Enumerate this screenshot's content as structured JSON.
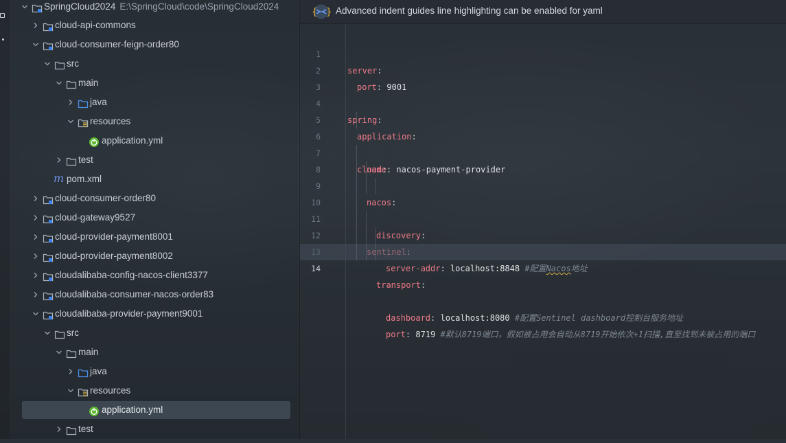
{
  "project": {
    "root": {
      "name": "SpringCloud2024",
      "path": "E:\\SpringCloud\\code\\SpringCloud2024"
    },
    "items": [
      {
        "label": "cloud-api-commons"
      },
      {
        "label": "cloud-consumer-feign-order80"
      },
      {
        "label": "src"
      },
      {
        "label": "main"
      },
      {
        "label": "java"
      },
      {
        "label": "resources"
      },
      {
        "label": "application.yml"
      },
      {
        "label": "test"
      },
      {
        "label": "pom.xml"
      },
      {
        "label": "cloud-consumer-order80"
      },
      {
        "label": "cloud-gateway9527"
      },
      {
        "label": "cloud-provider-payment8001"
      },
      {
        "label": "cloud-provider-payment8002"
      },
      {
        "label": "cloudalibaba-config-nacos-client3377"
      },
      {
        "label": "cloudalibaba-consumer-nacos-order83"
      },
      {
        "label": "cloudalibaba-provider-payment9001"
      },
      {
        "label": "src"
      },
      {
        "label": "main"
      },
      {
        "label": "java"
      },
      {
        "label": "resources"
      },
      {
        "label": "application.yml"
      },
      {
        "label": "test"
      }
    ]
  },
  "editor": {
    "banner": "Advanced indent guides line highlighting can be enabled for yaml",
    "current_line": 14,
    "lines": [
      {
        "n": "1",
        "key": "server",
        "colon": ":",
        "value": "",
        "comment": ""
      },
      {
        "n": "2",
        "key": "port",
        "colon": ":",
        "value": " 9001",
        "comment": ""
      },
      {
        "n": "3",
        "key": "",
        "colon": "",
        "value": "",
        "comment": ""
      },
      {
        "n": "4",
        "key": "spring",
        "colon": ":",
        "value": "",
        "comment": ""
      },
      {
        "n": "5",
        "key": "application",
        "colon": ":",
        "value": "",
        "comment": ""
      },
      {
        "n": "6",
        "key": "name",
        "colon": ":",
        "value": " nacos-payment-provider",
        "comment": ""
      },
      {
        "n": "7",
        "key": "cloud",
        "colon": ":",
        "value": "",
        "comment": ""
      },
      {
        "n": "8",
        "key": "nacos",
        "colon": ":",
        "value": "",
        "comment": ""
      },
      {
        "n": "9",
        "key": "discovery",
        "colon": ":",
        "value": "",
        "comment": ""
      },
      {
        "n": "10",
        "key": "server-addr",
        "colon": ":",
        "value": " localhost:8848 ",
        "comment_a": "#配置",
        "comment_b": "Nacos",
        "comment_c": "地址"
      },
      {
        "n": "11",
        "key": "sentinel",
        "colon": ":",
        "value": "",
        "comment": ""
      },
      {
        "n": "12",
        "key": "transport",
        "colon": ":",
        "value": "",
        "comment": ""
      },
      {
        "n": "13",
        "key": "dashboard",
        "colon": ":",
        "value": " localhost:8080 ",
        "comment": "#配置Sentinel dashboard控制台服务地址"
      },
      {
        "n": "14",
        "key": "port",
        "colon": ":",
        "value": " 8719 ",
        "comment": "#默认8719端口，假如被占用会自动从8719开始依次+1扫描,直至找到未被占用的端口"
      }
    ]
  }
}
